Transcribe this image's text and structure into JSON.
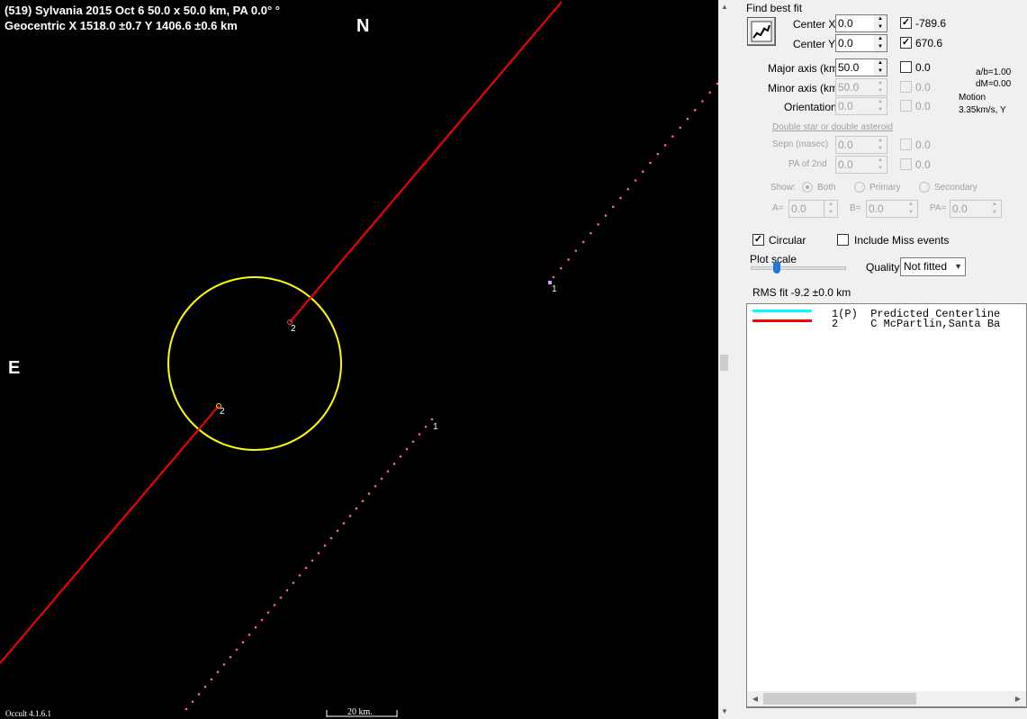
{
  "plot": {
    "header_line1": "(519) Sylvania  2015 Oct 6   50.0 x 50.0 km,  PA 0.0° °",
    "header_line2": "Geocentric  X  1518.0 ±0.7  Y 1406.6 ±0.6 km",
    "north_label": "N",
    "east_label": "E",
    "version": "Occult 4.1.6.1",
    "scale_label": "20 km.",
    "markers": {
      "chord2_disappear": "2",
      "chord2_reappear": "2",
      "chord1_upper": "1",
      "chord1_lower": "1"
    },
    "colors": {
      "background": "#000000",
      "ellipse": "#ffff00",
      "chord": "#ff0000",
      "dotted": "#ff6a6a"
    }
  },
  "fit": {
    "title": "Find best fit",
    "button_icon": "fit-chart-icon",
    "center_x_label": "Center X",
    "center_x_value": "0.0",
    "center_x_fit": "-789.6",
    "center_y_label": "Center Y",
    "center_y_value": "0.0",
    "center_y_fit": "670.6",
    "major_label": "Major axis (km)",
    "major_value": "50.0",
    "major_fit": "0.0",
    "minor_label": "Minor axis (km)",
    "minor_value": "50.0",
    "minor_fit": "0.0",
    "orient_label": "Orientation",
    "orient_value": "0.0",
    "orient_fit": "0.0",
    "ab_ratio": "a/b=1.00",
    "dm": "dM=0.00",
    "motion_label": "Motion",
    "motion_value": "3.35km/s, Y"
  },
  "double_star": {
    "title": "Double star  or  double asteroid",
    "sepn_label": "Sepn (masec)",
    "sepn_value": "0.0",
    "sepn_fit": "0.0",
    "pa2_label": "PA of 2nd",
    "pa2_value": "0.0",
    "pa2_fit": "0.0",
    "show_label": "Show:",
    "opt_both": "Both",
    "opt_primary": "Primary",
    "opt_secondary": "Secondary",
    "a_label": "A=",
    "a_value": "0.0",
    "b_label": "B=",
    "b_value": "0.0",
    "pa_label": "PA=",
    "pa_value": "0.0"
  },
  "options": {
    "circular_label": "Circular",
    "include_miss_label": "Include Miss events",
    "plot_scale_label": "Plot scale",
    "quality_label": "Quality",
    "quality_value": "Not fitted",
    "rms_fit": "RMS fit  -9.2 ±0.0 km"
  },
  "legend": [
    {
      "text": "1(P)  Predicted Centerline",
      "color": "#00ffff"
    },
    {
      "text": "2     C McPartlin,Santa Ba",
      "color": "#ff0000"
    }
  ]
}
